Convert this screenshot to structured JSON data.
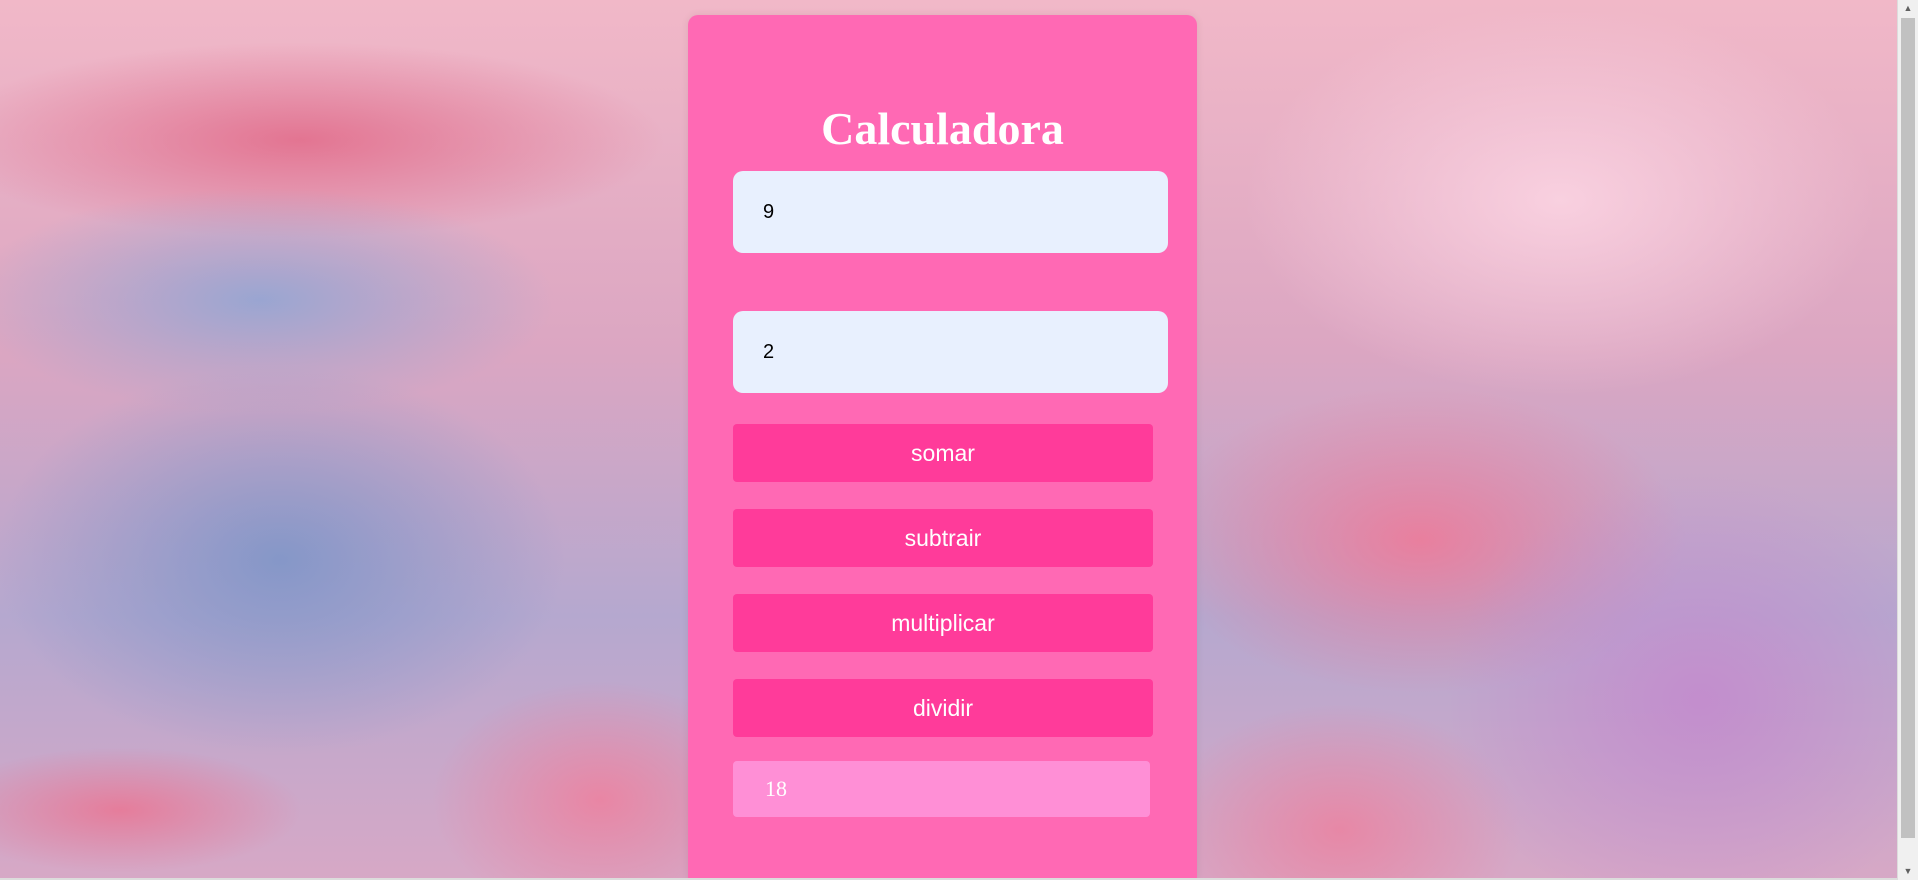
{
  "calculator": {
    "title": "Calculadora",
    "input_1_value": "9",
    "input_2_value": "2",
    "buttons": {
      "somar": "somar",
      "subtrair": "subtrair",
      "multiplicar": "multiplicar",
      "dividir": "dividir"
    },
    "result": "18"
  },
  "colors": {
    "panel": "#ff69b4",
    "button": "#ff3b9a",
    "input_bg": "#e8f0fe",
    "result_bg": "#ff8fd6",
    "text_light": "#ffffff"
  },
  "icons": {
    "scroll_up": "scroll-up-arrow-icon",
    "scroll_down": "scroll-down-arrow-icon"
  }
}
